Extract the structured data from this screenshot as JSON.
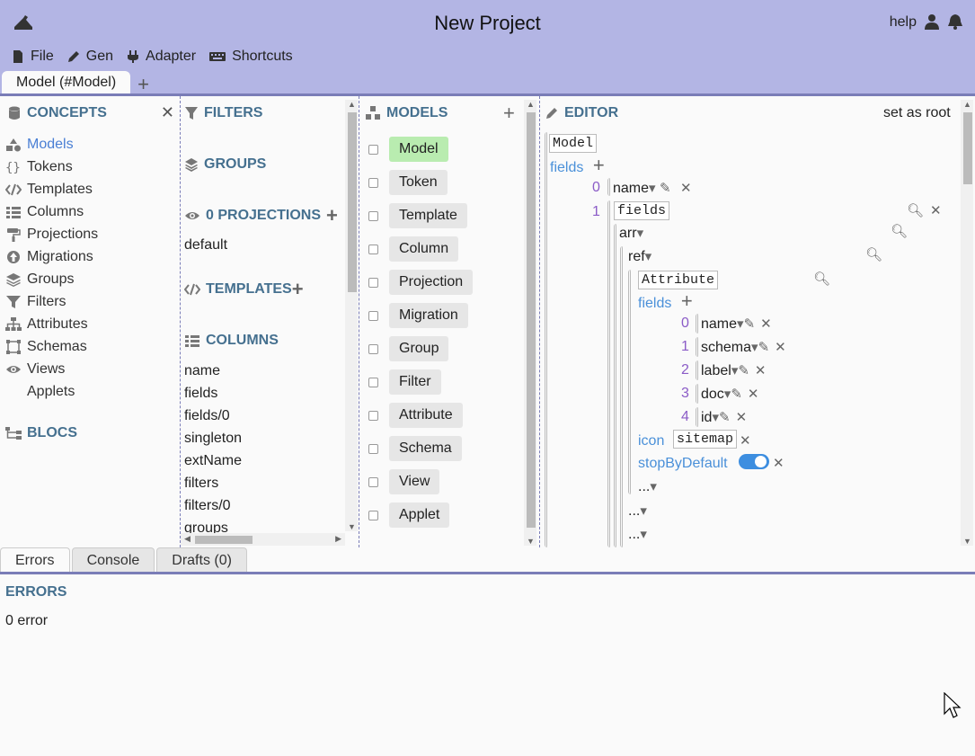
{
  "app": {
    "title": "New Project",
    "help": "help"
  },
  "menu": {
    "file": "File",
    "gen": "Gen",
    "adapter": "Adapter",
    "shortcuts": "Shortcuts"
  },
  "tab": {
    "active": "Model (#Model)",
    "add": "+"
  },
  "concepts": {
    "title": "CONCEPTS",
    "items": [
      "Models",
      "Tokens",
      "Templates",
      "Columns",
      "Projections",
      "Migrations",
      "Groups",
      "Filters",
      "Attributes",
      "Schemas",
      "Views",
      "Applets"
    ],
    "blocs": "BLOCS"
  },
  "filters": {
    "title": "FILTERS",
    "groups": "GROUPS",
    "projections": "0 PROJECTIONS",
    "projection_default": "default",
    "templates": "TEMPLATES",
    "columns_title": "COLUMNS",
    "columns": [
      "name",
      "fields",
      "fields/0",
      "singleton",
      "extName",
      "filters",
      "filters/0",
      "groups"
    ]
  },
  "models": {
    "title": "MODELS",
    "items": [
      "Model",
      "Token",
      "Template",
      "Column",
      "Projection",
      "Migration",
      "Group",
      "Filter",
      "Attribute",
      "Schema",
      "View",
      "Applet"
    ]
  },
  "editor": {
    "title": "EDITOR",
    "set_root": "set as root",
    "root_type": "Model",
    "fields_key": "fields",
    "idx0": "0",
    "idx1": "1",
    "name_val": "name",
    "fields_box": "fields",
    "arr": "arr",
    "ref": "ref",
    "attr_box": "Attribute",
    "inner_fields": "fields",
    "inner": [
      {
        "i": "0",
        "v": "name"
      },
      {
        "i": "1",
        "v": "schema"
      },
      {
        "i": "2",
        "v": "label"
      },
      {
        "i": "3",
        "v": "doc"
      },
      {
        "i": "4",
        "v": "id"
      }
    ],
    "icon_key": "icon",
    "icon_val": "sitemap",
    "stop_key": "stopByDefault",
    "ellipsis": "..."
  },
  "bottom": {
    "tabs": [
      "Errors",
      "Console",
      "Drafts (0)"
    ],
    "errors_title": "ERRORS",
    "error_count": "0 error"
  }
}
